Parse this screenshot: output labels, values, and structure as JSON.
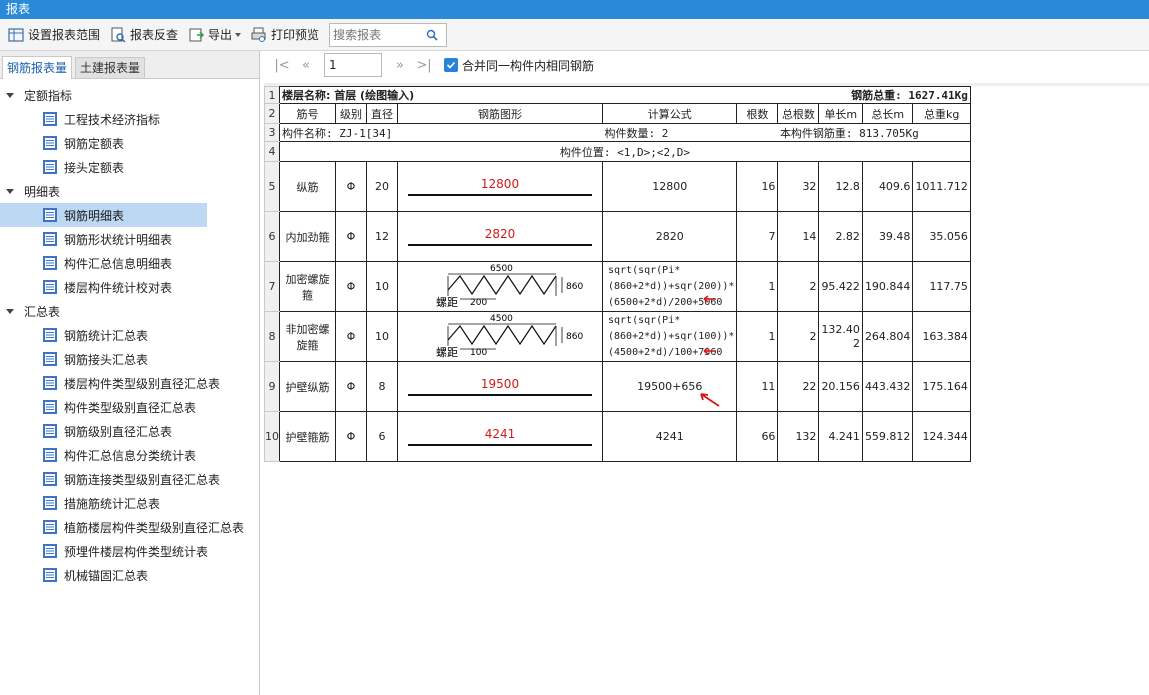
{
  "window": {
    "title": "报表"
  },
  "toolbar": {
    "set_range": "设置报表范围",
    "reverse_check": "报表反查",
    "export": "导出",
    "print_preview": "打印预览",
    "search_placeholder": "搜索报表"
  },
  "left_tabs": [
    {
      "label": "钢筋报表量"
    },
    {
      "label": "土建报表量"
    }
  ],
  "tree": {
    "group1": {
      "label": "定额指标",
      "items": [
        "工程技术经济指标",
        "钢筋定额表",
        "接头定额表"
      ]
    },
    "group2": {
      "label": "明细表",
      "items": [
        "钢筋明细表",
        "钢筋形状统计明细表",
        "构件汇总信息明细表",
        "楼层构件统计校对表"
      ]
    },
    "group3": {
      "label": "汇总表",
      "items": [
        "钢筋统计汇总表",
        "钢筋接头汇总表",
        "楼层构件类型级别直径汇总表",
        "构件类型级别直径汇总表",
        "钢筋级别直径汇总表",
        "构件汇总信息分类统计表",
        "钢筋连接类型级别直径汇总表",
        "措施筋统计汇总表",
        "植筋楼层构件类型级别直径汇总表",
        "预埋件楼层构件类型统计表",
        "机械锚固汇总表"
      ]
    }
  },
  "pager": {
    "page": "1",
    "merge_label": "合并同一构件内相同钢筋"
  },
  "report": {
    "floor_label": "楼层名称: 首层 (绘图输入)",
    "total_weight_label": "钢筋总重: 1627.41Kg",
    "headers": [
      "筋号",
      "级别",
      "直径",
      "钢筋图形",
      "计算公式",
      "根数",
      "总根数",
      "单长m",
      "总长m",
      "总重kg"
    ],
    "component_name": "构件名称: ZJ-1[34]",
    "component_count": "构件数量: 2",
    "component_weight": "本构件钢筋重: 813.705Kg",
    "component_position": "构件位置: <1,D>;<2,D>",
    "row_numbers": [
      "1",
      "2",
      "3",
      "4",
      "5",
      "6",
      "7",
      "8",
      "9",
      "10"
    ],
    "grade_symbol": "Φ",
    "rows": [
      {
        "name": "纵筋",
        "dia": "20",
        "shape": "12800",
        "formula": "12800",
        "count": "16",
        "total_count": "32",
        "unit_len": "12.8",
        "total_len": "409.6",
        "weight": "1011.712"
      },
      {
        "name": "内加劲箍",
        "dia": "12",
        "shape": "2820",
        "formula": "2820",
        "count": "7",
        "total_count": "14",
        "unit_len": "2.82",
        "total_len": "39.48",
        "weight": "35.056"
      },
      {
        "name": "加密螺旋箍",
        "dia": "10",
        "shape_top": "6500",
        "shape_side": "860",
        "shape_pitch_label": "螺距",
        "shape_pitch": "200",
        "formula": "sqrt(sqr(Pi*(860+2*d))+sqr(200))*(6500+2*d)/200+5060",
        "count": "1",
        "total_count": "2",
        "unit_len": "95.422",
        "total_len": "190.844",
        "weight": "117.75"
      },
      {
        "name": "非加密螺旋箍",
        "dia": "10",
        "shape_top": "4500",
        "shape_side": "860",
        "shape_pitch_label": "螺距",
        "shape_pitch": "100",
        "formula": "sqrt(sqr(Pi*(860+2*d))+sqr(100))*(4500+2*d)/100+7360",
        "count": "1",
        "total_count": "2",
        "unit_len": "132.402",
        "total_len": "264.804",
        "weight": "163.384"
      },
      {
        "name": "护壁纵筋",
        "dia": "8",
        "shape": "19500",
        "formula": "19500+656",
        "count": "11",
        "total_count": "22",
        "unit_len": "20.156",
        "total_len": "443.432",
        "weight": "175.164"
      },
      {
        "name": "护壁箍筋",
        "dia": "6",
        "shape": "4241",
        "formula": "4241",
        "count": "66",
        "total_count": "132",
        "unit_len": "4.241",
        "total_len": "559.812",
        "weight": "124.344"
      }
    ]
  },
  "colors": {
    "accent": "#2b8ad8",
    "selected": "#bcd8f2",
    "red_mark": "#d21a1a"
  },
  "icons": [
    "settings-range-icon",
    "report-reverse-icon",
    "export-icon",
    "print-preview-icon",
    "search-icon",
    "expand-arrow-icon",
    "report-doc-icon",
    "first-page-icon",
    "prev-page-icon",
    "next-page-icon",
    "last-page-icon",
    "checkbox-checked-icon",
    "red-arrow-icon"
  ]
}
